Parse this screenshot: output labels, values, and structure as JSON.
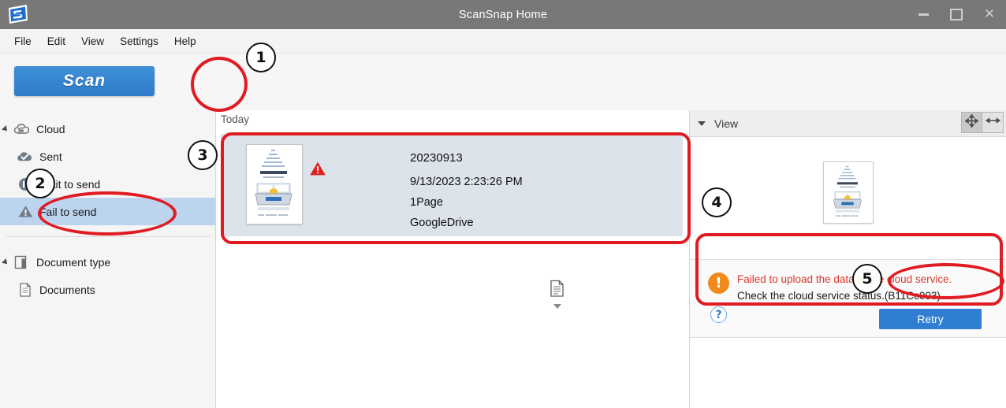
{
  "window": {
    "title": "ScanSnap Home",
    "logo_icon": "scansnap-logo-icon",
    "minimize_label": "Minimize",
    "maximize_label": "Maximize",
    "close_label": "Close"
  },
  "menu": {
    "items": [
      {
        "label": "File"
      },
      {
        "label": "Edit"
      },
      {
        "label": "View"
      },
      {
        "label": "Settings"
      },
      {
        "label": "Help"
      }
    ]
  },
  "toolbar": {
    "scan_label": "Scan",
    "toggles": [
      {
        "name": "pc-view-toggle",
        "icon": "monitor-icon",
        "active": false
      },
      {
        "name": "cloud-view-toggle",
        "icon": "cloud-icon",
        "active": true,
        "badge": "!"
      }
    ]
  },
  "sidebar": {
    "groups": [
      {
        "label": "Cloud",
        "icon": "cloud-icon",
        "expanded": true,
        "items": [
          {
            "label": "Sent",
            "icon": "sent-check-cloud-icon",
            "selected": false
          },
          {
            "label": "Wait to send",
            "icon": "pause-icon",
            "selected": false
          },
          {
            "label": "Fail to send",
            "icon": "warning-triangle-icon",
            "selected": true
          }
        ]
      },
      {
        "label": "Document type",
        "icon": "document-type-icon",
        "expanded": true,
        "items": [
          {
            "label": "Documents",
            "icon": "document-icon",
            "selected": false
          }
        ]
      }
    ]
  },
  "list": {
    "section_header": "Today",
    "items": [
      {
        "title": "20230913",
        "datetime": "9/13/2023 2:23:26 PM",
        "pages": "1Page",
        "destination": "GoogleDrive",
        "status_icon": "warning-triangle-icon",
        "type_icon": "document-icon",
        "thumbnail_icon": "scanner-document-thumbnail",
        "selected": true
      }
    ]
  },
  "view_panel": {
    "header_label": "View",
    "collapse_icon": "chevron-down-icon",
    "buttons": [
      {
        "name": "pan-tool-button",
        "icon": "move-arrows-icon",
        "active": true
      },
      {
        "name": "fit-width-button",
        "icon": "horizontal-resize-icon",
        "active": false
      }
    ],
    "preview_icon": "scanner-document-thumbnail",
    "error": {
      "icon": "alert-circle-icon",
      "help_icon": "help-question-icon",
      "line1": "Failed to upload the data to the cloud service.",
      "line2": "Check the cloud service status.(B11Cc003)",
      "retry_label": "Retry"
    }
  },
  "annotations": {
    "markers": [
      {
        "number": "1",
        "target": "cloud-view-toggle"
      },
      {
        "number": "2",
        "target": "sidebar-item-fail-to-send"
      },
      {
        "number": "3",
        "target": "document-list-item"
      },
      {
        "number": "4",
        "target": "error-panel"
      },
      {
        "number": "5",
        "target": "retry-button"
      }
    ]
  },
  "colors": {
    "accent_blue": "#2f7ed4",
    "annotation_red": "#e11b22",
    "error_text": "#d83a2e",
    "alert_orange": "#f08a1c",
    "titlebar_gray": "#787878",
    "selection_blue": "#bcd4ee",
    "card_blue": "#dce3ea"
  }
}
